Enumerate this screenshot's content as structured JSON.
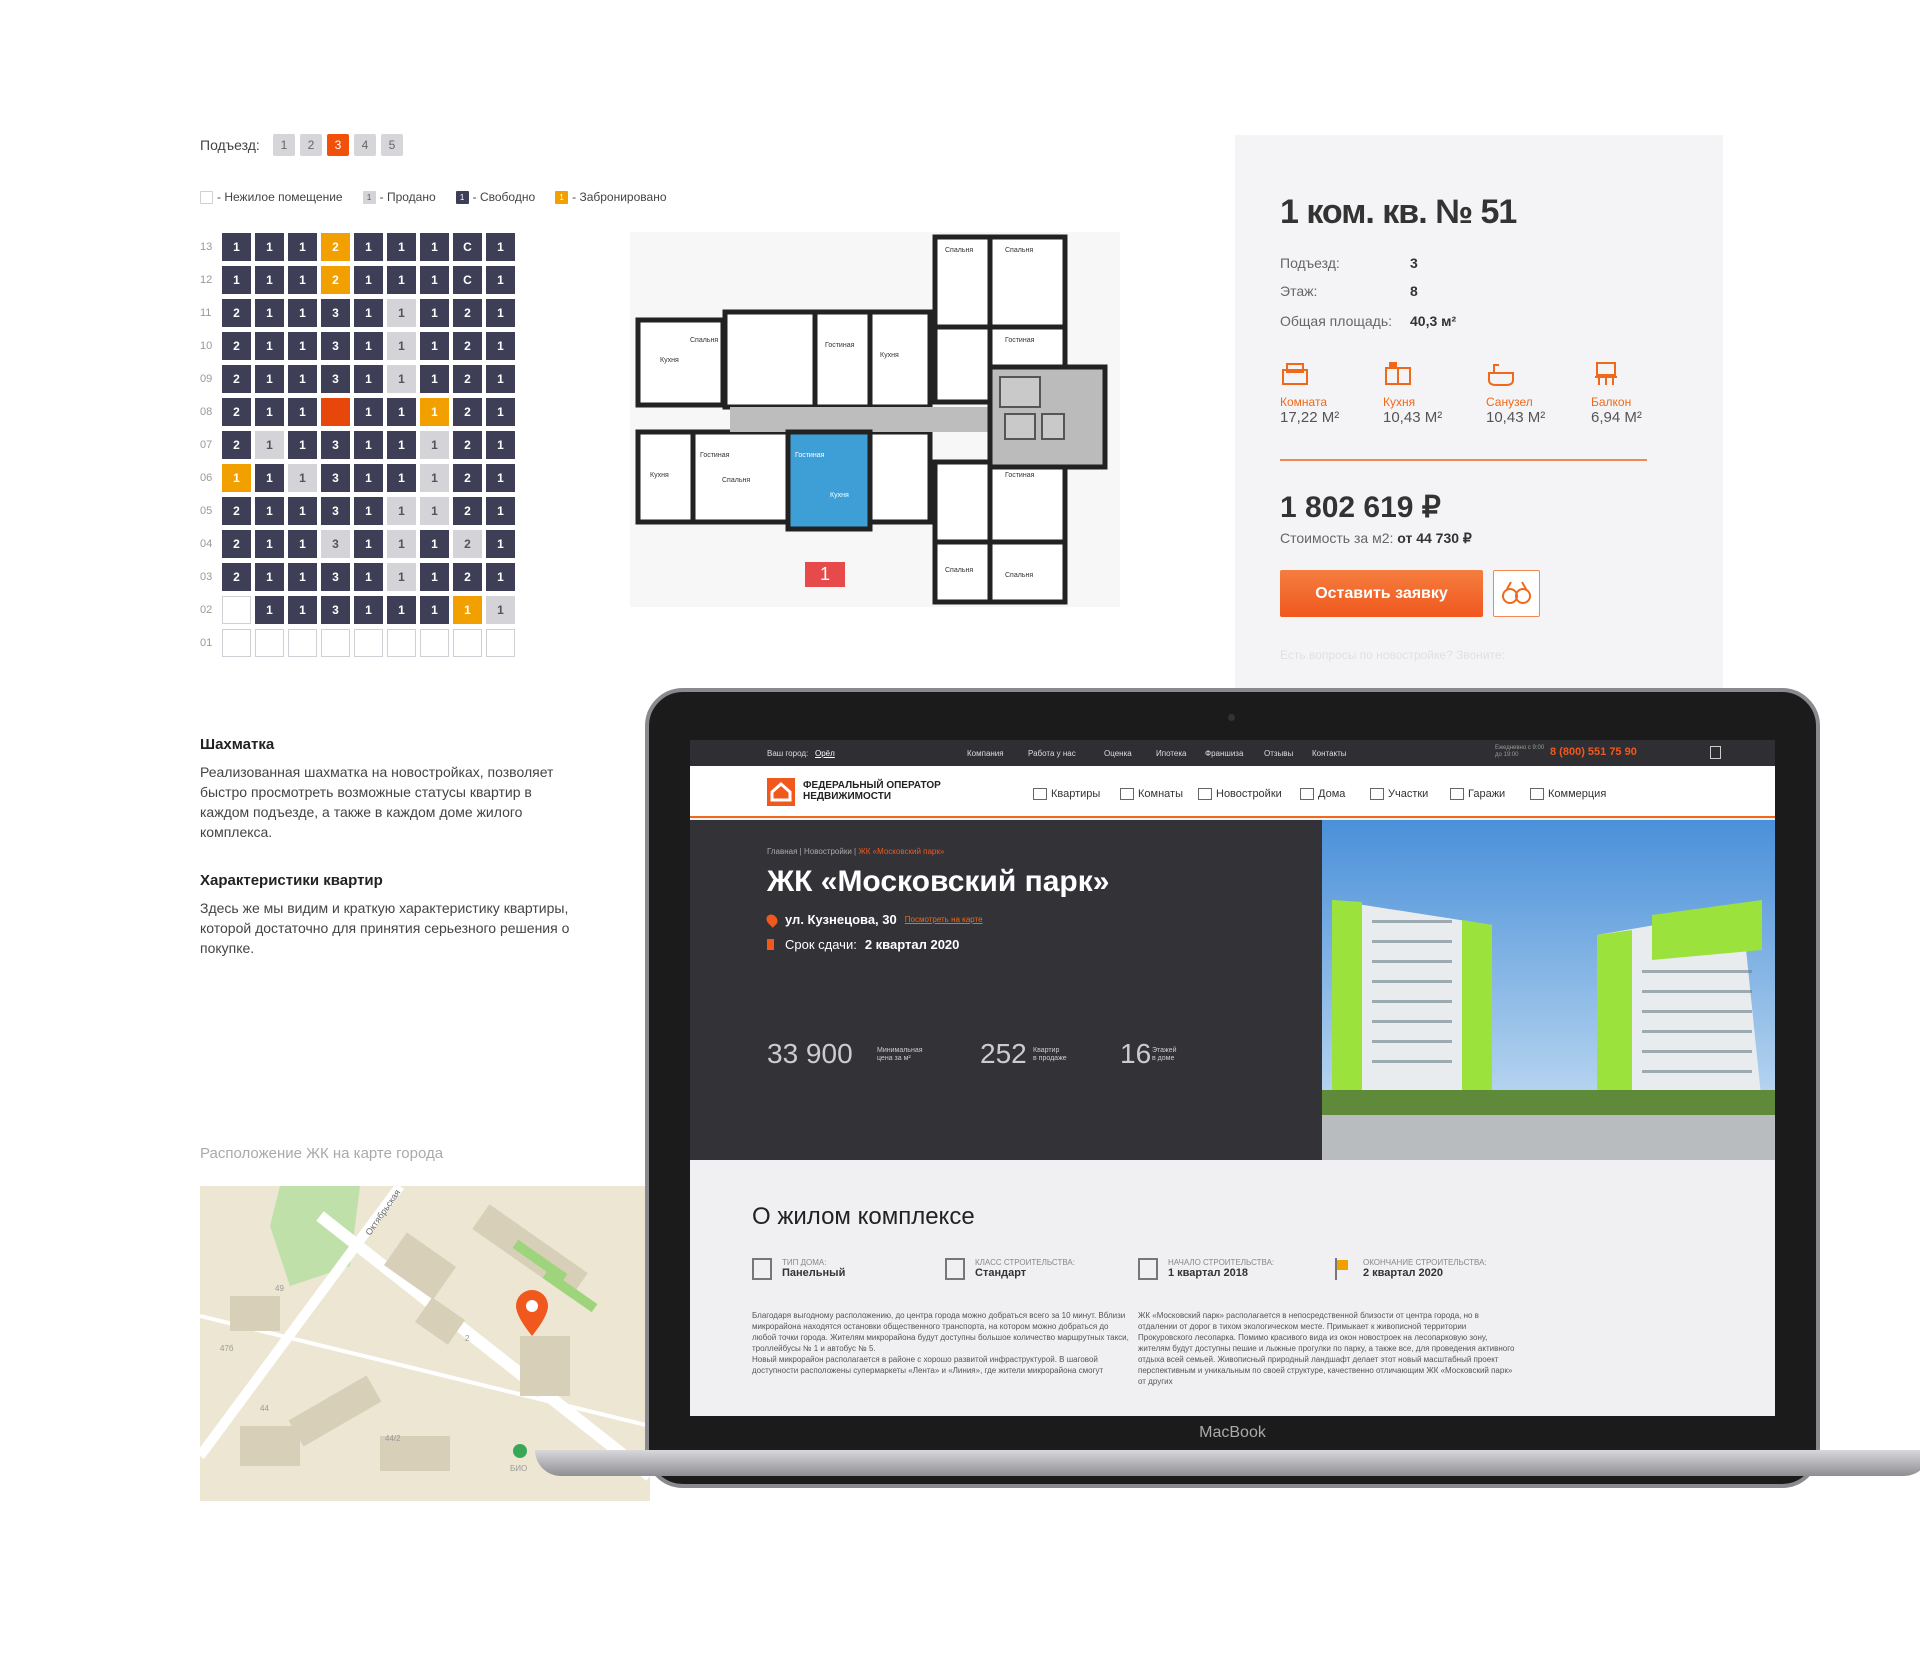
{
  "entrances": {
    "label": "Подъезд:",
    "tabs": [
      "1",
      "2",
      "3",
      "4",
      "5"
    ],
    "active": "3"
  },
  "legend": [
    {
      "swatch": "",
      "label": "- Нежилое помещение",
      "kind": "empty"
    },
    {
      "swatch": "1",
      "label": "- Продано",
      "kind": "sold"
    },
    {
      "swatch": "1",
      "label": "- Свободно",
      "kind": "free"
    },
    {
      "swatch": "1",
      "label": "- Забронировано",
      "kind": "res"
    }
  ],
  "grid": {
    "rows": [
      {
        "floor": "13",
        "cells": [
          [
            "1",
            "f"
          ],
          [
            "1",
            "f"
          ],
          [
            "1",
            "f"
          ],
          [
            "2",
            "r"
          ],
          [
            "1",
            "f"
          ],
          [
            "1",
            "f"
          ],
          [
            "1",
            "f"
          ],
          [
            "C",
            "f"
          ],
          [
            "1",
            "f"
          ]
        ]
      },
      {
        "floor": "12",
        "cells": [
          [
            "1",
            "f"
          ],
          [
            "1",
            "f"
          ],
          [
            "1",
            "f"
          ],
          [
            "2",
            "r"
          ],
          [
            "1",
            "f"
          ],
          [
            "1",
            "f"
          ],
          [
            "1",
            "f"
          ],
          [
            "C",
            "f"
          ],
          [
            "1",
            "f"
          ]
        ]
      },
      {
        "floor": "11",
        "cells": [
          [
            "2",
            "f"
          ],
          [
            "1",
            "f"
          ],
          [
            "1",
            "f"
          ],
          [
            "3",
            "f"
          ],
          [
            "1",
            "f"
          ],
          [
            "1",
            "s"
          ],
          [
            "1",
            "f"
          ],
          [
            "2",
            "f"
          ],
          [
            "1",
            "f"
          ]
        ]
      },
      {
        "floor": "10",
        "cells": [
          [
            "2",
            "f"
          ],
          [
            "1",
            "f"
          ],
          [
            "1",
            "f"
          ],
          [
            "3",
            "f"
          ],
          [
            "1",
            "f"
          ],
          [
            "1",
            "s"
          ],
          [
            "1",
            "f"
          ],
          [
            "2",
            "f"
          ],
          [
            "1",
            "f"
          ]
        ]
      },
      {
        "floor": "09",
        "cells": [
          [
            "2",
            "f"
          ],
          [
            "1",
            "f"
          ],
          [
            "1",
            "f"
          ],
          [
            "3",
            "f"
          ],
          [
            "1",
            "f"
          ],
          [
            "1",
            "s"
          ],
          [
            "1",
            "f"
          ],
          [
            "2",
            "f"
          ],
          [
            "1",
            "f"
          ]
        ]
      },
      {
        "floor": "08",
        "cells": [
          [
            "2",
            "f"
          ],
          [
            "1",
            "f"
          ],
          [
            "1",
            "f"
          ],
          [
            "",
            "x"
          ],
          [
            "1",
            "f"
          ],
          [
            "1",
            "f"
          ],
          [
            "1",
            "r"
          ],
          [
            "2",
            "f"
          ],
          [
            "1",
            "f"
          ]
        ]
      },
      {
        "floor": "07",
        "cells": [
          [
            "2",
            "f"
          ],
          [
            "1",
            "s"
          ],
          [
            "1",
            "f"
          ],
          [
            "3",
            "f"
          ],
          [
            "1",
            "f"
          ],
          [
            "1",
            "f"
          ],
          [
            "1",
            "s"
          ],
          [
            "2",
            "f"
          ],
          [
            "1",
            "f"
          ]
        ]
      },
      {
        "floor": "06",
        "cells": [
          [
            "1",
            "r"
          ],
          [
            "1",
            "f"
          ],
          [
            "1",
            "s"
          ],
          [
            "3",
            "f"
          ],
          [
            "1",
            "f"
          ],
          [
            "1",
            "f"
          ],
          [
            "1",
            "s"
          ],
          [
            "2",
            "f"
          ],
          [
            "1",
            "f"
          ]
        ]
      },
      {
        "floor": "05",
        "cells": [
          [
            "2",
            "f"
          ],
          [
            "1",
            "f"
          ],
          [
            "1",
            "f"
          ],
          [
            "3",
            "f"
          ],
          [
            "1",
            "f"
          ],
          [
            "1",
            "s"
          ],
          [
            "1",
            "s"
          ],
          [
            "2",
            "f"
          ],
          [
            "1",
            "f"
          ]
        ]
      },
      {
        "floor": "04",
        "cells": [
          [
            "2",
            "f"
          ],
          [
            "1",
            "f"
          ],
          [
            "1",
            "f"
          ],
          [
            "3",
            "s"
          ],
          [
            "1",
            "f"
          ],
          [
            "1",
            "s"
          ],
          [
            "1",
            "f"
          ],
          [
            "2",
            "s"
          ],
          [
            "1",
            "f"
          ]
        ]
      },
      {
        "floor": "03",
        "cells": [
          [
            "2",
            "f"
          ],
          [
            "1",
            "f"
          ],
          [
            "1",
            "f"
          ],
          [
            "3",
            "f"
          ],
          [
            "1",
            "f"
          ],
          [
            "1",
            "s"
          ],
          [
            "1",
            "f"
          ],
          [
            "2",
            "f"
          ],
          [
            "1",
            "f"
          ]
        ]
      },
      {
        "floor": "02",
        "cells": [
          [
            "",
            "e"
          ],
          [
            "1",
            "f"
          ],
          [
            "1",
            "f"
          ],
          [
            "3",
            "f"
          ],
          [
            "1",
            "f"
          ],
          [
            "1",
            "f"
          ],
          [
            "1",
            "f"
          ],
          [
            "1",
            "r"
          ],
          [
            "1",
            "s"
          ]
        ]
      },
      {
        "floor": "01",
        "cells": [
          [
            "",
            "e"
          ],
          [
            "",
            "e"
          ],
          [
            "",
            "e"
          ],
          [
            "",
            "e"
          ],
          [
            "",
            "e"
          ],
          [
            "",
            "e"
          ],
          [
            "",
            "e"
          ],
          [
            "",
            "e"
          ],
          [
            "",
            "e"
          ]
        ]
      }
    ]
  },
  "floorplan": {
    "marker": "1"
  },
  "apartment": {
    "title": "1 ком. кв. № 51",
    "entrance_label": "Подъезд:",
    "entrance": "3",
    "floor_label": "Этаж:",
    "floor": "8",
    "area_label": "Общая площадь:",
    "area": "40,3 м²",
    "rooms": [
      {
        "label": "Комната",
        "value": "17,22 М²",
        "icon": "room-icon"
      },
      {
        "label": "Кухня",
        "value": "10,43 М²",
        "icon": "kitchen-icon"
      },
      {
        "label": "Санузел",
        "value": "10,43 М²",
        "icon": "bathroom-icon"
      },
      {
        "label": "Балкон",
        "value": "6,94 М²",
        "icon": "balcony-icon"
      }
    ],
    "price": "1 802 619 ₽",
    "per_m2_label": "Стоимость за м2:",
    "per_m2": "от 44 730 ₽",
    "cta": "Оставить заявку",
    "faded": "Есть вопросы по новостройке? Звоните:"
  },
  "features": {
    "chess_title": "Шахматка",
    "chess_text": "Реализованная шахматка на новостройках, позволяет быстро просмотреть возможные статусы квартир в каждом подъезде, а также в каждом доме жилого комплекса.",
    "specs_title": "Характеристики квартир",
    "specs_text": "Здесь же мы видим и краткую характеристику квартиры, которой достаточно для принятия серьезного решения о покупке."
  },
  "map": {
    "title": "Расположение ЖК на карте города",
    "street": "Октябрьская",
    "labels": [
      "49",
      "47б",
      "44",
      "44/2",
      "2",
      "БИО"
    ]
  },
  "laptop": {
    "brand": "MacBook",
    "topbar": {
      "city_label": "Ваш город:",
      "city": "Орёл",
      "links": [
        "Компания",
        "Работа у нас",
        "Оценка",
        "Ипотека",
        "Франшиза",
        "Отзывы",
        "Контакты"
      ],
      "hours": "Ежедневно с 9:00 до 19:00",
      "phone": "8 (800) 551 75 90"
    },
    "logo": "ФЕДЕРАЛЬНЫЙ ОПЕРАТОР НЕДВИЖИМОСТИ",
    "nav": [
      "Квартиры",
      "Комнаты",
      "Новостройки",
      "Дома",
      "Участки",
      "Гаражи",
      "Коммерция"
    ],
    "breadcrumb": [
      "Главная",
      "Новостройки",
      "ЖК «Московский парк»"
    ],
    "title": "ЖК «Московский парк»",
    "address": "ул. Кузнецова, 30",
    "map_link": "Посмотреть на карте",
    "deadline_label": "Срок сдачи:",
    "deadline": "2 квартал 2020",
    "stats": [
      {
        "value": "33 900",
        "label1": "Минимальная",
        "label2": "цена за м²"
      },
      {
        "value": "252",
        "label1": "Квартир",
        "label2": "в продаже"
      },
      {
        "value": "16",
        "label1": "Этажей",
        "label2": "в доме"
      }
    ],
    "about_title": "О жилом комплексе",
    "about_items": [
      {
        "label": "ТИП ДОМА:",
        "value": "Панельный"
      },
      {
        "label": "КЛАСС СТРОИТЕЛЬСТВА:",
        "value": "Стандарт"
      },
      {
        "label": "НАЧАЛО СТРОИТЕЛЬСТВА:",
        "value": "1 квартал 2018"
      },
      {
        "label": "ОКОНЧАНИЕ СТРОИТЕЛЬСТВА:",
        "value": "2 квартал 2020"
      }
    ],
    "text_left": "Благодаря выгодному расположению, до центра города можно добраться всего за 10 минут. Вблизи микрорайона находятся остановки общественного транспорта, на котором можно добраться до любой точки города. Жителям микрорайона будут доступны большое количество маршрутных такси, троллейбусы № 1 и автобус № 5.",
    "text_left2": "Новый микрорайон располагается в районе с хорошо развитой инфраструктурой. В шаговой доступности расположены супермаркеты «Лента» и «Линия», где жители микрорайона смогут",
    "text_right": "ЖК «Московский парк» располагается в непосредственной близости от центра города, но в отдалении от дорог в тихом экологическом месте. Примыкает к живописной территории Прокуровского лесопарка. Помимо красивого вида из окон новостроек на лесопарковую зону, жителям будут доступны пешие и лыжные прогулки по парку, а также все, для проведения активного отдыха всей семьей. Живописный природный ландшафт делает этот новый масштабный проект перспективным и уникальным по своей структуре, качественно отличающим ЖК «Московский парк» от других"
  },
  "colors": {
    "accent": "#f0691a",
    "free": "#3e3f57",
    "sold": "#d3d3d8",
    "reserved": "#f2a000",
    "selected": "#e8470c"
  }
}
